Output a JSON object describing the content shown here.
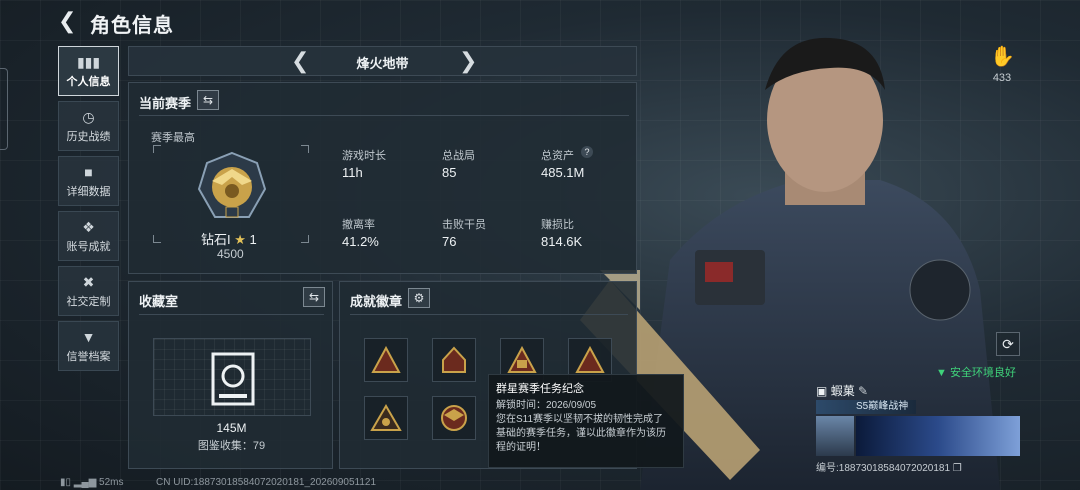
{
  "header": {
    "title": "角色信息"
  },
  "sidebar": {
    "items": [
      {
        "label": "个人信息",
        "icon": "bar-chart-icon"
      },
      {
        "label": "历史战绩",
        "icon": "clock-icon"
      },
      {
        "label": "详细数据",
        "icon": "folder-icon"
      },
      {
        "label": "账号成就",
        "icon": "medal-icon"
      },
      {
        "label": "社交定制",
        "icon": "tools-icon"
      },
      {
        "label": "信誉档案",
        "icon": "shield-icon"
      }
    ]
  },
  "mode_selector": {
    "label": "烽火地带"
  },
  "season": {
    "title": "当前赛季",
    "highest_label": "赛季最高",
    "rank": "钻石I",
    "stars": "1",
    "points": "4500",
    "stats": [
      {
        "label": "游戏时长",
        "value": "11h"
      },
      {
        "label": "总战局",
        "value": "85"
      },
      {
        "label": "总资产",
        "value": "485.1M"
      },
      {
        "label": "撤离率",
        "value": "41.2%"
      },
      {
        "label": "击败干员",
        "value": "76"
      },
      {
        "label": "赚损比",
        "value": "814.6K"
      }
    ],
    "help_icon": "?"
  },
  "collection": {
    "title": "收藏室",
    "value": "145M",
    "gallery_label": "图鉴收集：",
    "gallery_count": "79"
  },
  "achievements": {
    "title": "成就徽章"
  },
  "tooltip": {
    "title": "群星赛季任务纪念",
    "unlock_time": "解锁时间：2026/09/05",
    "desc_1": "您在S11赛季以坚韧不拔的韧性完成了",
    "desc_2": "基础的赛季任务，谨以此徽章作为该历",
    "desc_3": "程的证明！"
  },
  "likes": {
    "count": "433"
  },
  "safety": {
    "label": "安全环境良好"
  },
  "player": {
    "name": "蝦菓",
    "title": "S5巅峰战神",
    "id_line": "编号:18873018584072020181"
  },
  "status_bar": {
    "ping": "52ms",
    "uid": "CN UID:18873018584072020181_202609051121"
  },
  "colors": {
    "accent_green": "#3fd27a",
    "gold": "#c9a24a",
    "panel": "#202b33"
  }
}
